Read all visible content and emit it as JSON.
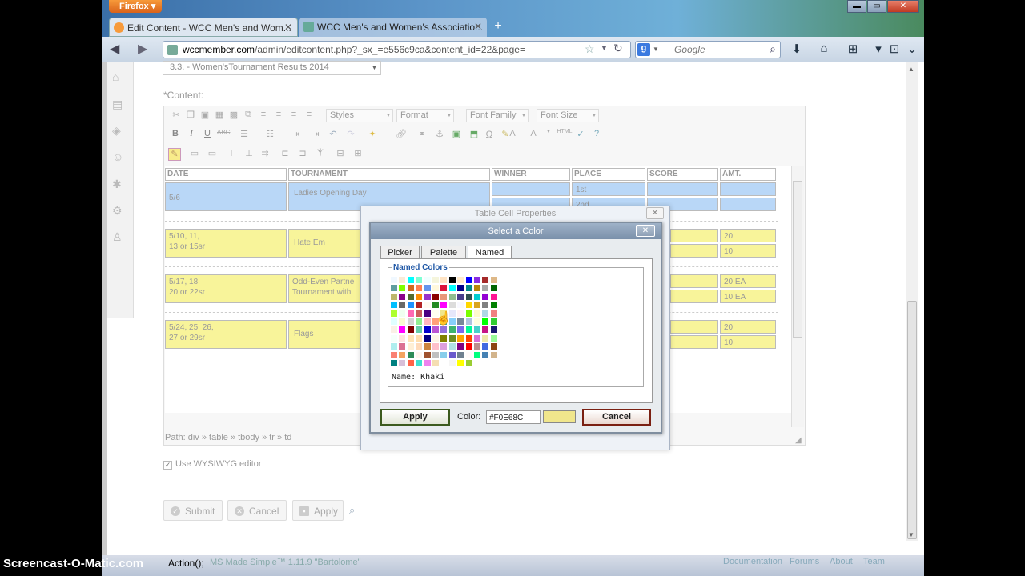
{
  "browser": {
    "app_button": "Firefox",
    "tabs": [
      {
        "title": "Edit Content - WCC Men's and Wom..."
      },
      {
        "title": "WCC Men's and Women's Associatio..."
      }
    ],
    "url_domain": "wccmember.com",
    "url_path": "/admin/editcontent.php?_sx_=e556c9ca&content_id=22&page=",
    "search_placeholder": "Google",
    "search_engine_icon": "g-icon"
  },
  "editor": {
    "page_select": "3.3. - Women'sTournament Results 2014",
    "content_label": "*Content:",
    "toolbar": {
      "styles": "Styles",
      "format": "Format",
      "font_family": "Font Family",
      "font_size": "Font Size"
    },
    "path": "Path: div » table » tbody » tr » td",
    "wysiwyg_label": "Use WYSIWYG editor",
    "buttons": {
      "submit": "Submit",
      "cancel": "Cancel",
      "apply": "Apply"
    }
  },
  "table": {
    "headers": [
      "DATE",
      "TOURNAMENT",
      "WINNER",
      "PLACE",
      "SCORE",
      "AMT."
    ],
    "rows": [
      {
        "date": "5/6",
        "tournament": "Ladies Opening Day",
        "place1": "1st",
        "place2": "2nd"
      },
      {
        "date1": "5/10, 11,",
        "date2": "13 or 15sr",
        "tournament": "Hate Em",
        "amt1": "20",
        "amt2": "10"
      },
      {
        "date1": "5/17, 18,",
        "date2": "20 or 22sr",
        "tournament1": "Odd-Even Partne",
        "tournament2": "Tournament with",
        "amt1": "20 EA",
        "amt2": "10 EA"
      },
      {
        "date1": "5/24, 25, 26,",
        "date2": " 27 or 29sr",
        "tournament": "Flags",
        "amt1": "20",
        "amt2": "10"
      }
    ]
  },
  "cell_dialog": {
    "title": "Table Cell Properties"
  },
  "color_dialog": {
    "title": "Select a Color",
    "tabs": [
      "Picker",
      "Palette",
      "Named"
    ],
    "active_tab": "Named",
    "legend": "Named Colors",
    "name_label": "Name: Khaki",
    "apply": "Apply",
    "color_label": "Color:",
    "color_value": "#F0E68C",
    "cancel": "Cancel",
    "swatches": [
      [
        "#f0f8ff",
        "#faebd7",
        "#00ffff",
        "#7fffd4",
        "#f0ffff",
        "#f5f5dc",
        "#ffe4c4",
        "#000000",
        "#ffebcd",
        "#0000ff",
        "#8a2be2",
        "#a52a2a",
        "#deb887"
      ],
      [
        "#5f9ea0",
        "#7fff00",
        "#d2691e",
        "#ff7f50",
        "#6495ed",
        "#fff8dc",
        "#dc143c",
        "#00ffff",
        "#00008b",
        "#008b8b",
        "#b8860b",
        "#a9a9a9",
        "#006400"
      ],
      [
        "#bdb76b",
        "#8b008b",
        "#556b2f",
        "#ff8c00",
        "#9932cc",
        "#8b0000",
        "#e9967a",
        "#8fbc8f",
        "#483d8b",
        "#2f4f4f",
        "#00ced1",
        "#9400d3",
        "#ff1493"
      ],
      [
        "#00bfff",
        "#696969",
        "#1e90ff",
        "#b22222",
        "#fffaf0",
        "#228b22",
        "#ff00ff",
        "#dcdcdc",
        "#f8f8ff",
        "#ffd700",
        "#daa520",
        "#808080",
        "#008000"
      ],
      [
        "#adff2f",
        "#f0fff0",
        "#ff69b4",
        "#cd5c5c",
        "#4b0082",
        "#fffff0",
        "#f0e68c",
        "#e6e6fa",
        "#fff0f5",
        "#7cfc00",
        "#fffacd",
        "#add8e6",
        "#f08080"
      ],
      [
        "#e0ffff",
        "#fafad2",
        "#d3d3d3",
        "#90ee90",
        "#ffb6c1",
        "#ffa07a",
        "#20b2aa",
        "#87cefa",
        "#778899",
        "#b0c4de",
        "#ffffe0",
        "#00ff00",
        "#32cd32"
      ],
      [
        "#faf0e6",
        "#ff00ff",
        "#800000",
        "#66cdaa",
        "#0000cd",
        "#ba55d3",
        "#9370db",
        "#3cb371",
        "#7b68ee",
        "#00fa9a",
        "#48d1cc",
        "#c71585",
        "#191970"
      ],
      [
        "#f5fffa",
        "#ffe4e1",
        "#ffe4b5",
        "#ffdead",
        "#000080",
        "#fdf5e6",
        "#808000",
        "#6b8e23",
        "#ffa500",
        "#ff4500",
        "#da70d6",
        "#eee8aa",
        "#98fb98"
      ],
      [
        "#afeeee",
        "#db7093",
        "#ffefd5",
        "#ffdab9",
        "#cd853f",
        "#ffc0cb",
        "#dda0dd",
        "#b0e0e6",
        "#800080",
        "#ff0000",
        "#bc8f8f",
        "#4169e1",
        "#8b4513"
      ],
      [
        "#fa8072",
        "#f4a460",
        "#2e8b57",
        "#fff5ee",
        "#a0522d",
        "#c0c0c0",
        "#87ceeb",
        "#6a5acd",
        "#708090",
        "#fffafa",
        "#00ff7f",
        "#4682b4",
        "#d2b48c"
      ],
      [
        "#008080",
        "#d8bfd8",
        "#ff6347",
        "#40e0d0",
        "#ee82ee",
        "#f5deb3",
        "#ffffff",
        "#f5f5f5",
        "#ffff00",
        "#9acd32"
      ]
    ]
  }
}
